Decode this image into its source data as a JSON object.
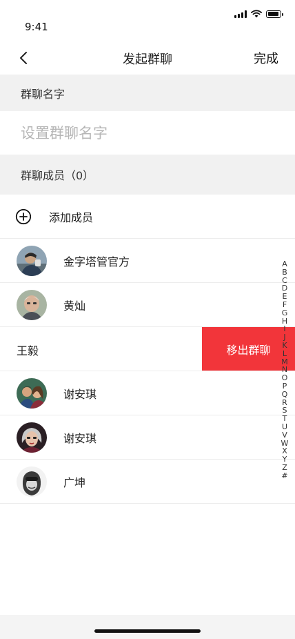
{
  "status_bar": {
    "time": "9:41",
    "battery_level": 0.9
  },
  "nav": {
    "title": "发起群聊",
    "done_label": "完成",
    "back_icon": "chevron-left-icon"
  },
  "group_name": {
    "header": "群聊名字",
    "placeholder": "设置群聊名字"
  },
  "members": {
    "header": "群聊成员（0）",
    "add_label": "添加成员",
    "add_icon": "plus-circle-icon",
    "list": [
      {
        "name": "金字塔管官方"
      },
      {
        "name": "黄灿"
      },
      {
        "name": "王毅",
        "swiped": true,
        "action_label": "移出群聊"
      },
      {
        "name": "谢安琪"
      },
      {
        "name": "谢安琪"
      },
      {
        "name": "广坤"
      }
    ]
  },
  "alpha_index": [
    "A",
    "B",
    "C",
    "D",
    "E",
    "F",
    "G",
    "H",
    "I",
    "J",
    "K",
    "L",
    "M",
    "N",
    "O",
    "P",
    "Q",
    "R",
    "S",
    "T",
    "U",
    "V",
    "W",
    "X",
    "Y",
    "Z",
    "#"
  ],
  "colors": {
    "accent_danger": "#f2353a",
    "section_bg": "#f1f1f1",
    "placeholder": "#b6b6b6"
  }
}
